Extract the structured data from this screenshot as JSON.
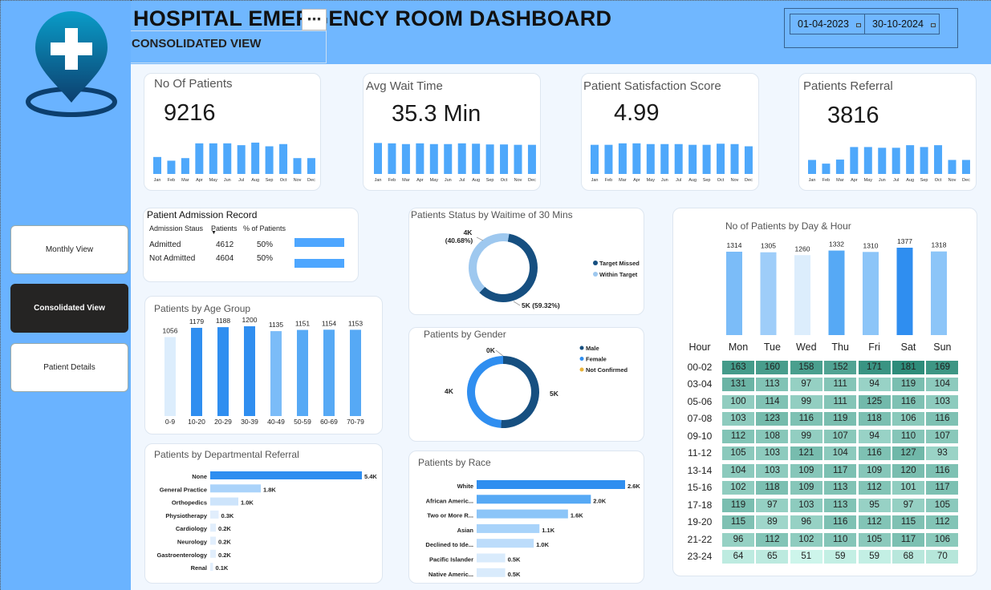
{
  "header": {
    "title": "HOSPITAL EMERGENCY ROOM DASHBOARD",
    "subtitle": "CONSOLIDATED VIEW",
    "more_glyph": "⋯",
    "date_from": "01-04-2023",
    "date_to": "30-10-2024"
  },
  "nav": {
    "monthly": "Monthly View",
    "consolidated": "Consolidated View",
    "details": "Patient Details"
  },
  "months": [
    "Jan",
    "Feb",
    "Mar",
    "Apr",
    "May",
    "Jun",
    "Jul",
    "Aug",
    "Sep",
    "Oct",
    "Nov",
    "Dec"
  ],
  "kpis": [
    {
      "title": "No Of Patients",
      "value": "9216",
      "spark": [
        46,
        36,
        43,
        83,
        83,
        83,
        78,
        85,
        75,
        81,
        43,
        43
      ]
    },
    {
      "title": "Avg Wait Time",
      "value": "35.3 Min",
      "spark": [
        84,
        83,
        81,
        83,
        81,
        81,
        83,
        82,
        80,
        80,
        79,
        79
      ]
    },
    {
      "title": "Patient Satisfaction Score",
      "value": "4.99",
      "spark": [
        79,
        79,
        83,
        83,
        81,
        81,
        81,
        79,
        79,
        82,
        81,
        75
      ]
    },
    {
      "title": "Patients Referral",
      "value": "3816",
      "spark": [
        38,
        28,
        39,
        73,
        73,
        71,
        71,
        78,
        73,
        78,
        38,
        38
      ]
    }
  ],
  "admission": {
    "title": "Patient Admission Record",
    "headers": [
      "Admission Staus",
      "Patients",
      "% of Patients"
    ],
    "sort_glyph": "▼",
    "rows": [
      {
        "label": "Admitted",
        "patients": "4612",
        "pct": "50%",
        "pct_value": 50
      },
      {
        "label": "Not Admitted",
        "patients": "4604",
        "pct": "50%",
        "pct_value": 50
      }
    ],
    "bar_color": "#4da6ff"
  },
  "chart_data": [
    {
      "type": "bar",
      "title": "Patients by Age Group",
      "categories": [
        "0-9",
        "10-20",
        "20-29",
        "30-39",
        "40-49",
        "50-59",
        "60-69",
        "70-79"
      ],
      "values": [
        1056,
        1179,
        1188,
        1200,
        1135,
        1151,
        1154,
        1153
      ],
      "labels": [
        "1056",
        "1179",
        "1188",
        "1200",
        "1135",
        "1151",
        "1154",
        "1153"
      ],
      "colors": [
        "#dcedfc",
        "#2f8ef0",
        "#2f8ef0",
        "#2f8ef0",
        "#7bbcf8",
        "#56a9f5",
        "#56a9f5",
        "#56a9f5"
      ]
    },
    {
      "type": "pie",
      "title": "Patients Status by Waitime of 30 Mins",
      "slices": [
        {
          "name": "Target Missed",
          "value": 59.32,
          "label": "5K (59.32%)",
          "color": "#164f80"
        },
        {
          "name": "Within Target",
          "value": 40.68,
          "label": "4K",
          "label2": "(40.68%)",
          "color": "#9ec8ef"
        }
      ]
    },
    {
      "type": "pie",
      "title": "Patients by Gender",
      "slices": [
        {
          "name": "Male",
          "value": 51,
          "label": "5K",
          "color": "#164f80"
        },
        {
          "name": "Female",
          "value": 49,
          "label": "4K",
          "color": "#2f8ef0"
        },
        {
          "name": "Not Confirmed",
          "value": 0,
          "label": "0K",
          "color": "#e8b33a"
        }
      ]
    },
    {
      "type": "bar",
      "orientation": "horizontal",
      "title": "Patients by Departmental Referral",
      "categories": [
        "None",
        "General Practice",
        "Orthopedics",
        "Physiotherapy",
        "Cardiology",
        "Neurology",
        "Gastroenterology",
        "Renal"
      ],
      "values": [
        5.4,
        1.8,
        1.0,
        0.3,
        0.2,
        0.2,
        0.2,
        0.1
      ],
      "labels": [
        "5.4K",
        "1.8K",
        "1.0K",
        "0.3K",
        "0.2K",
        "0.2K",
        "0.2K",
        "0.1K"
      ],
      "colors": [
        "#2f8ef0",
        "#aad3fa",
        "#cde4fb",
        "#e1eefc",
        "#e1eefc",
        "#e1eefc",
        "#e1eefc",
        "#e1eefc"
      ]
    },
    {
      "type": "bar",
      "orientation": "horizontal",
      "title": "Patients by Race",
      "categories": [
        "White",
        "African Americ...",
        "Two or More R...",
        "Asian",
        "Declined to Ide...",
        "Pacific Islander",
        "Native Americ..."
      ],
      "values": [
        2.6,
        2.0,
        1.6,
        1.1,
        1.0,
        0.5,
        0.5
      ],
      "labels": [
        "2.6K",
        "2.0K",
        "1.6K",
        "1.1K",
        "1.0K",
        "0.5K",
        "0.5K"
      ],
      "colors": [
        "#2f8ef0",
        "#56a9f5",
        "#8cc5f8",
        "#a8d3fa",
        "#bcdcfb",
        "#d9ebfc",
        "#d9ebfc"
      ]
    },
    {
      "type": "bar",
      "title": "No of Patients by Day & Hour",
      "categories": [
        "Mon",
        "Tue",
        "Wed",
        "Thu",
        "Fri",
        "Sat",
        "Sun"
      ],
      "values": [
        1314,
        1305,
        1260,
        1332,
        1310,
        1377,
        1318
      ],
      "labels": [
        "1314",
        "1305",
        "1260",
        "1332",
        "1310",
        "1377",
        "1318"
      ],
      "colors": [
        "#7bbcf8",
        "#9ecdf9",
        "#dcedfc",
        "#56a9f5",
        "#8cc5f8",
        "#2f8ef0",
        "#8cc5f8"
      ]
    },
    {
      "type": "heatmap",
      "corner": "Hour",
      "columns": [
        "Mon",
        "Tue",
        "Wed",
        "Thu",
        "Fri",
        "Sat",
        "Sun"
      ],
      "rows": [
        "00-02",
        "03-04",
        "05-06",
        "07-08",
        "09-10",
        "11-12",
        "13-14",
        "15-16",
        "17-18",
        "19-20",
        "21-22",
        "23-24"
      ],
      "values": [
        [
          163,
          160,
          158,
          152,
          171,
          181,
          169
        ],
        [
          131,
          113,
          97,
          111,
          94,
          119,
          104
        ],
        [
          100,
          114,
          99,
          111,
          125,
          116,
          103
        ],
        [
          103,
          123,
          116,
          119,
          118,
          106,
          116
        ],
        [
          112,
          108,
          99,
          107,
          94,
          110,
          107
        ],
        [
          105,
          103,
          121,
          104,
          116,
          127,
          93
        ],
        [
          104,
          103,
          109,
          117,
          109,
          120,
          116
        ],
        [
          102,
          118,
          109,
          113,
          112,
          101,
          117
        ],
        [
          119,
          97,
          103,
          113,
          95,
          97,
          105
        ],
        [
          115,
          89,
          96,
          116,
          112,
          115,
          112
        ],
        [
          96,
          112,
          102,
          110,
          105,
          117,
          106
        ],
        [
          64,
          65,
          51,
          59,
          59,
          68,
          70
        ]
      ]
    }
  ]
}
